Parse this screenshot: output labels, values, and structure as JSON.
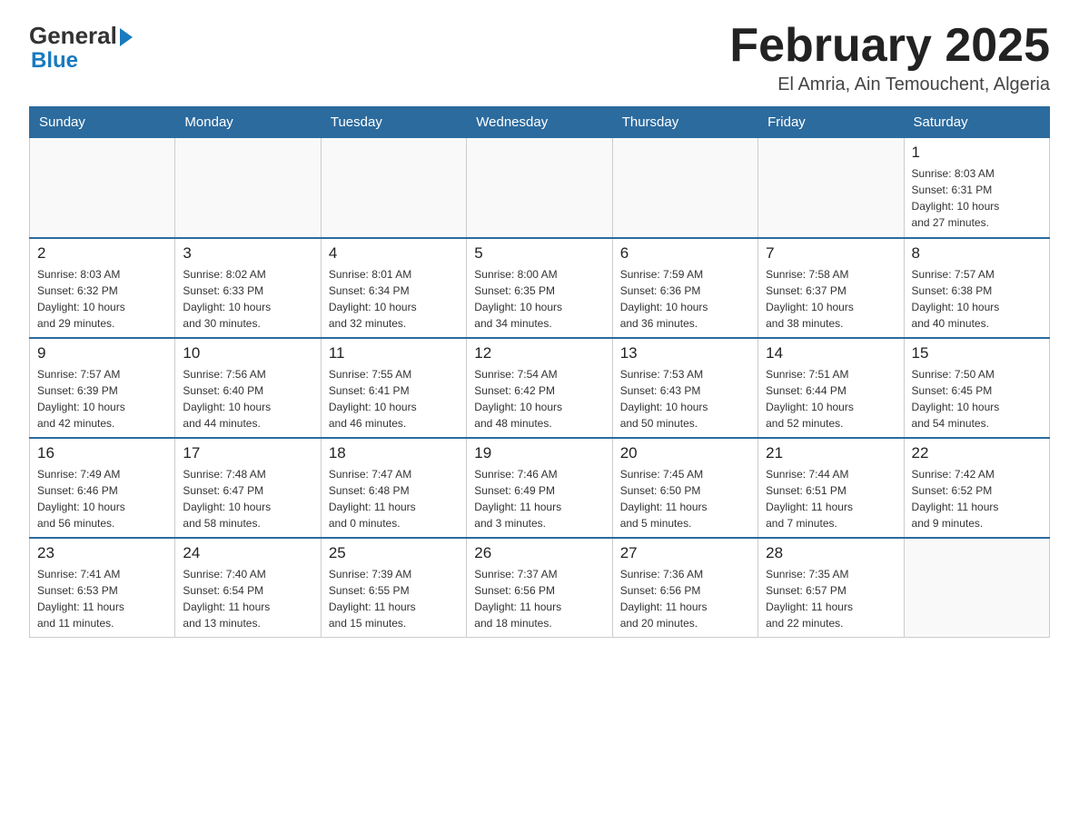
{
  "logo": {
    "general": "General",
    "blue": "Blue"
  },
  "header": {
    "title": "February 2025",
    "location": "El Amria, Ain Temouchent, Algeria"
  },
  "weekdays": [
    "Sunday",
    "Monday",
    "Tuesday",
    "Wednesday",
    "Thursday",
    "Friday",
    "Saturday"
  ],
  "weeks": [
    [
      {
        "day": "",
        "info": ""
      },
      {
        "day": "",
        "info": ""
      },
      {
        "day": "",
        "info": ""
      },
      {
        "day": "",
        "info": ""
      },
      {
        "day": "",
        "info": ""
      },
      {
        "day": "",
        "info": ""
      },
      {
        "day": "1",
        "info": "Sunrise: 8:03 AM\nSunset: 6:31 PM\nDaylight: 10 hours\nand 27 minutes."
      }
    ],
    [
      {
        "day": "2",
        "info": "Sunrise: 8:03 AM\nSunset: 6:32 PM\nDaylight: 10 hours\nand 29 minutes."
      },
      {
        "day": "3",
        "info": "Sunrise: 8:02 AM\nSunset: 6:33 PM\nDaylight: 10 hours\nand 30 minutes."
      },
      {
        "day": "4",
        "info": "Sunrise: 8:01 AM\nSunset: 6:34 PM\nDaylight: 10 hours\nand 32 minutes."
      },
      {
        "day": "5",
        "info": "Sunrise: 8:00 AM\nSunset: 6:35 PM\nDaylight: 10 hours\nand 34 minutes."
      },
      {
        "day": "6",
        "info": "Sunrise: 7:59 AM\nSunset: 6:36 PM\nDaylight: 10 hours\nand 36 minutes."
      },
      {
        "day": "7",
        "info": "Sunrise: 7:58 AM\nSunset: 6:37 PM\nDaylight: 10 hours\nand 38 minutes."
      },
      {
        "day": "8",
        "info": "Sunrise: 7:57 AM\nSunset: 6:38 PM\nDaylight: 10 hours\nand 40 minutes."
      }
    ],
    [
      {
        "day": "9",
        "info": "Sunrise: 7:57 AM\nSunset: 6:39 PM\nDaylight: 10 hours\nand 42 minutes."
      },
      {
        "day": "10",
        "info": "Sunrise: 7:56 AM\nSunset: 6:40 PM\nDaylight: 10 hours\nand 44 minutes."
      },
      {
        "day": "11",
        "info": "Sunrise: 7:55 AM\nSunset: 6:41 PM\nDaylight: 10 hours\nand 46 minutes."
      },
      {
        "day": "12",
        "info": "Sunrise: 7:54 AM\nSunset: 6:42 PM\nDaylight: 10 hours\nand 48 minutes."
      },
      {
        "day": "13",
        "info": "Sunrise: 7:53 AM\nSunset: 6:43 PM\nDaylight: 10 hours\nand 50 minutes."
      },
      {
        "day": "14",
        "info": "Sunrise: 7:51 AM\nSunset: 6:44 PM\nDaylight: 10 hours\nand 52 minutes."
      },
      {
        "day": "15",
        "info": "Sunrise: 7:50 AM\nSunset: 6:45 PM\nDaylight: 10 hours\nand 54 minutes."
      }
    ],
    [
      {
        "day": "16",
        "info": "Sunrise: 7:49 AM\nSunset: 6:46 PM\nDaylight: 10 hours\nand 56 minutes."
      },
      {
        "day": "17",
        "info": "Sunrise: 7:48 AM\nSunset: 6:47 PM\nDaylight: 10 hours\nand 58 minutes."
      },
      {
        "day": "18",
        "info": "Sunrise: 7:47 AM\nSunset: 6:48 PM\nDaylight: 11 hours\nand 0 minutes."
      },
      {
        "day": "19",
        "info": "Sunrise: 7:46 AM\nSunset: 6:49 PM\nDaylight: 11 hours\nand 3 minutes."
      },
      {
        "day": "20",
        "info": "Sunrise: 7:45 AM\nSunset: 6:50 PM\nDaylight: 11 hours\nand 5 minutes."
      },
      {
        "day": "21",
        "info": "Sunrise: 7:44 AM\nSunset: 6:51 PM\nDaylight: 11 hours\nand 7 minutes."
      },
      {
        "day": "22",
        "info": "Sunrise: 7:42 AM\nSunset: 6:52 PM\nDaylight: 11 hours\nand 9 minutes."
      }
    ],
    [
      {
        "day": "23",
        "info": "Sunrise: 7:41 AM\nSunset: 6:53 PM\nDaylight: 11 hours\nand 11 minutes."
      },
      {
        "day": "24",
        "info": "Sunrise: 7:40 AM\nSunset: 6:54 PM\nDaylight: 11 hours\nand 13 minutes."
      },
      {
        "day": "25",
        "info": "Sunrise: 7:39 AM\nSunset: 6:55 PM\nDaylight: 11 hours\nand 15 minutes."
      },
      {
        "day": "26",
        "info": "Sunrise: 7:37 AM\nSunset: 6:56 PM\nDaylight: 11 hours\nand 18 minutes."
      },
      {
        "day": "27",
        "info": "Sunrise: 7:36 AM\nSunset: 6:56 PM\nDaylight: 11 hours\nand 20 minutes."
      },
      {
        "day": "28",
        "info": "Sunrise: 7:35 AM\nSunset: 6:57 PM\nDaylight: 11 hours\nand 22 minutes."
      },
      {
        "day": "",
        "info": ""
      }
    ]
  ]
}
